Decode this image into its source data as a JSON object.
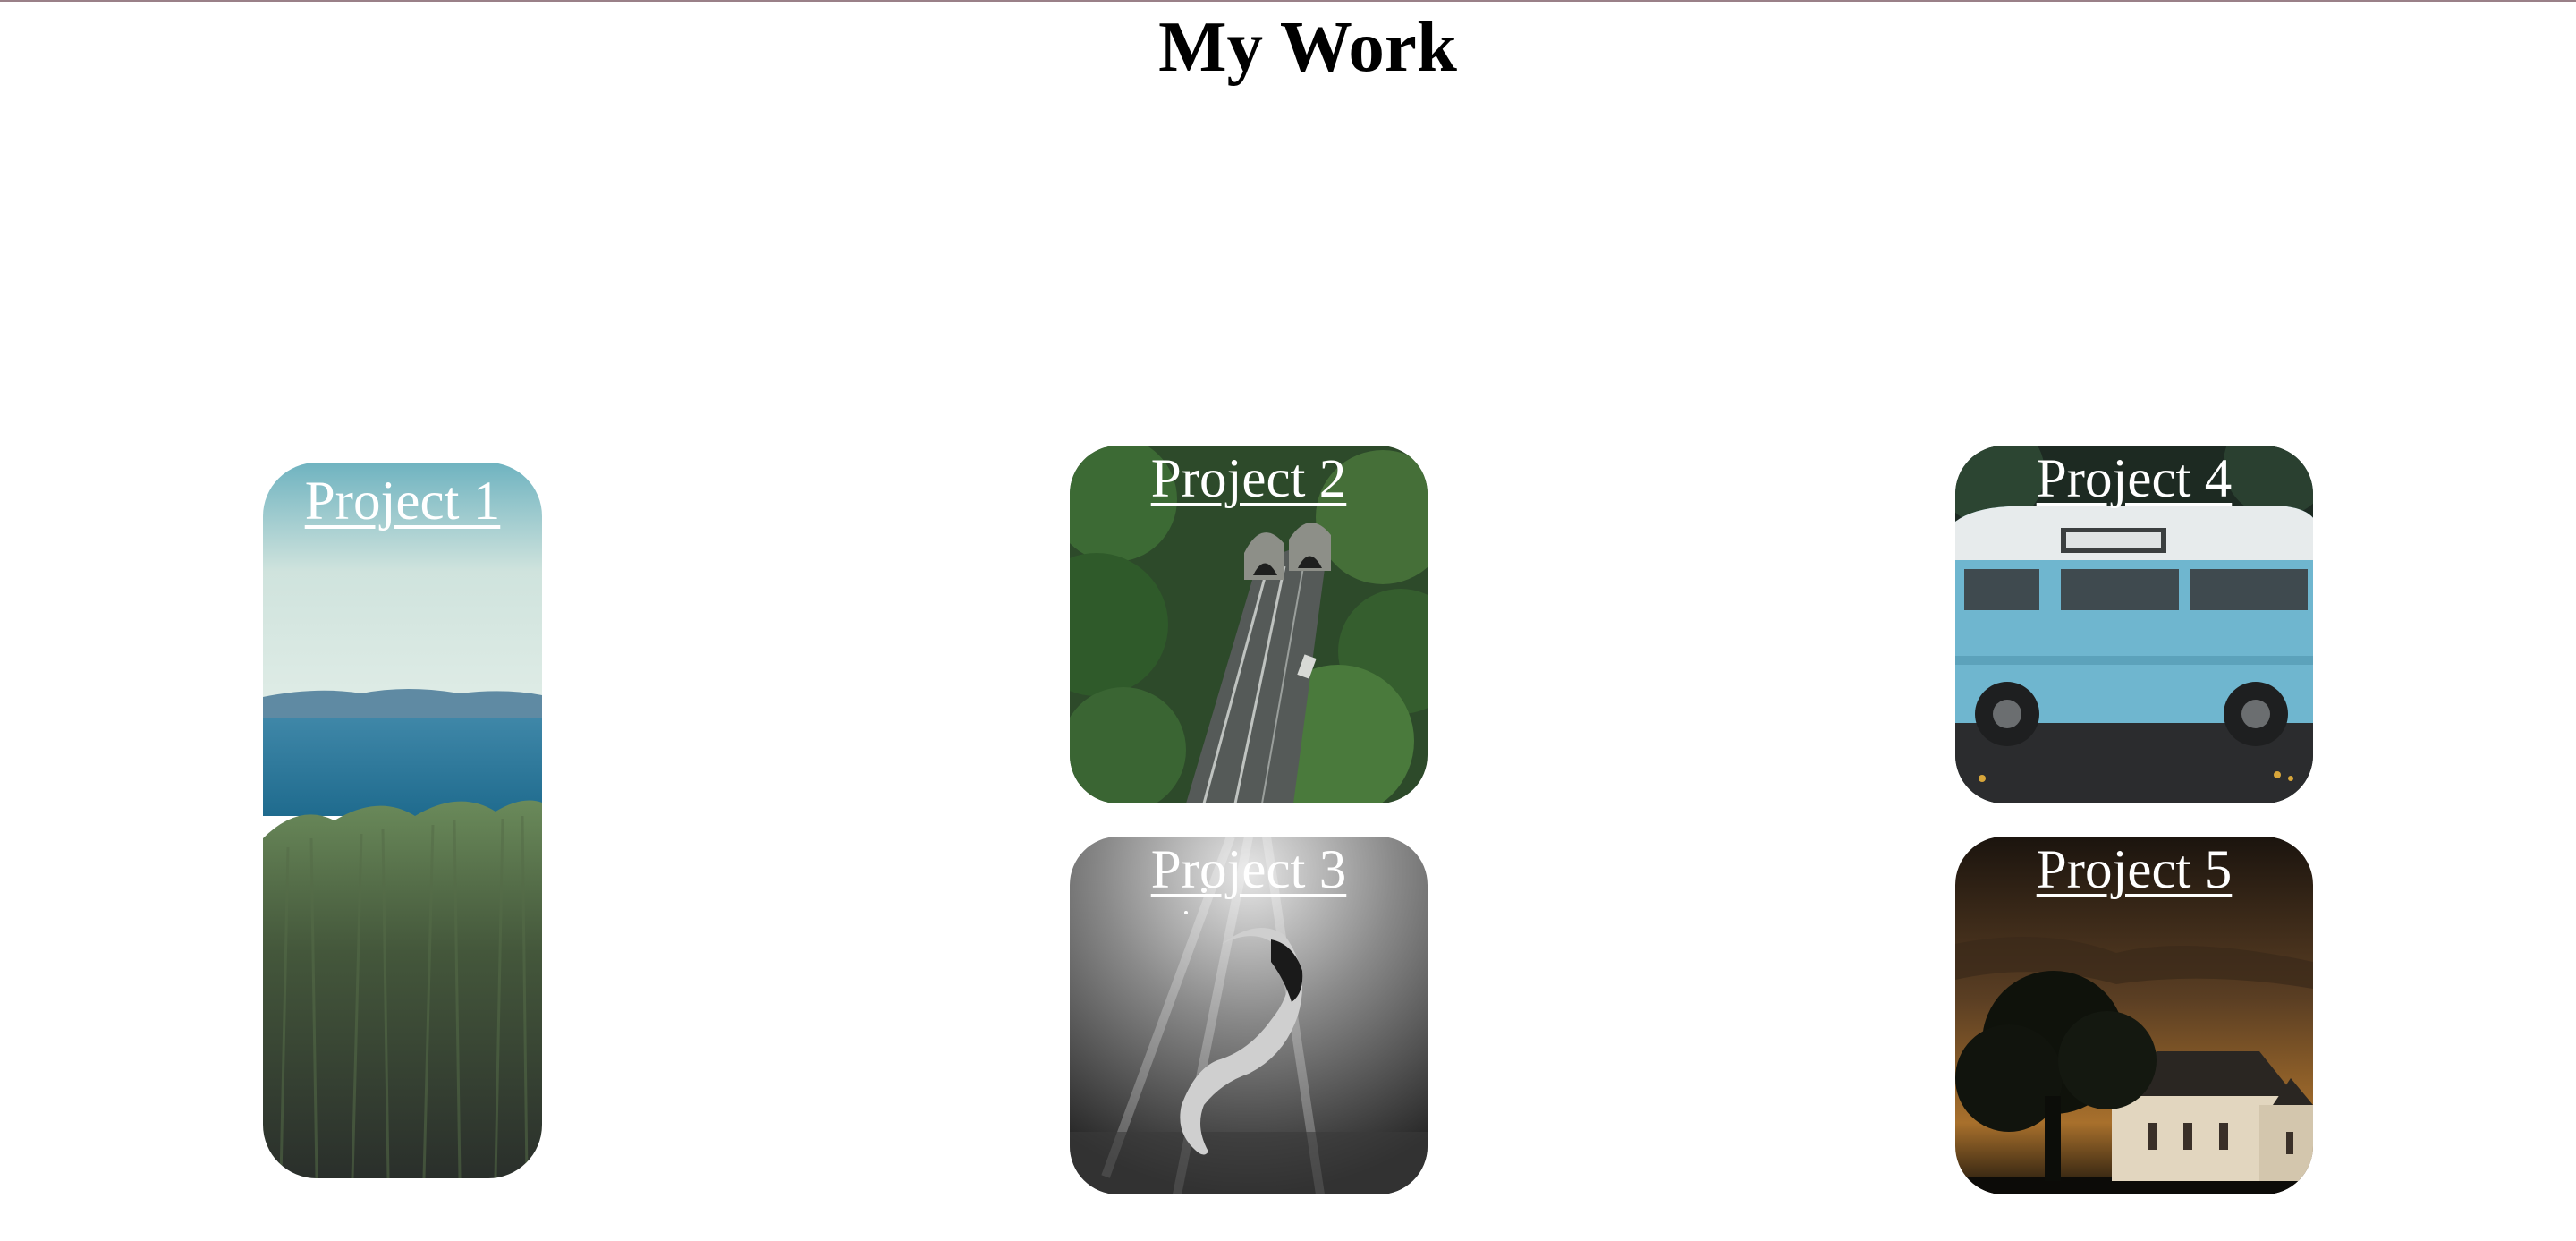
{
  "page": {
    "title": "My Work"
  },
  "projects": [
    {
      "label": "Project 1",
      "image": "coastal-field-photo"
    },
    {
      "label": "Project 2",
      "image": "aerial-forest-tunnel-photo"
    },
    {
      "label": "Project 3",
      "image": "underwater-swimmer-bw-photo"
    },
    {
      "label": "Project 4",
      "image": "blue-vintage-van-photo"
    },
    {
      "label": "Project 5",
      "image": "church-at-dusk-photo"
    }
  ],
  "colors": {
    "background": "#ffffff",
    "title_text": "#000000",
    "label_text": "#ffffff",
    "top_border": "#9a8088"
  }
}
